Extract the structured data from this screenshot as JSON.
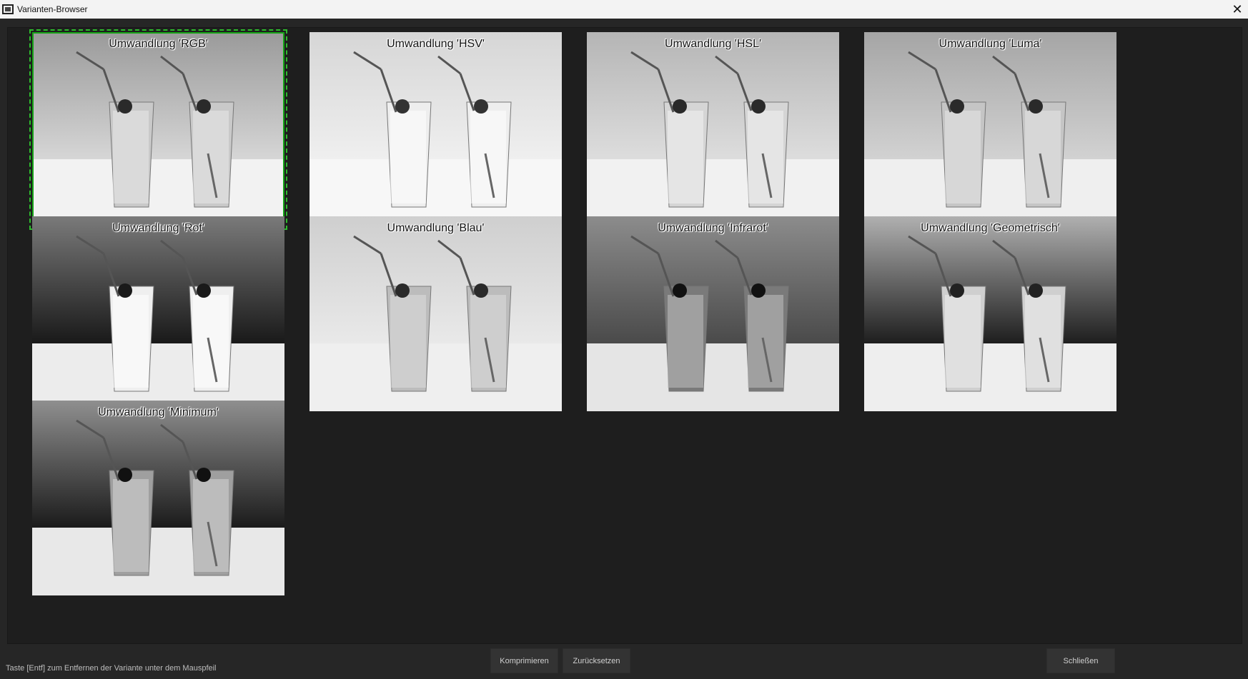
{
  "window": {
    "title": "Varianten-Browser",
    "close_icon": "close-icon",
    "app_icon": "film-icon"
  },
  "variants": [
    {
      "label": "Umwandlung 'RGB'",
      "selected": true,
      "tone": "rgb"
    },
    {
      "label": "Umwandlung 'HSV'",
      "selected": false,
      "tone": "hsv"
    },
    {
      "label": "Umwandlung 'HSL'",
      "selected": false,
      "tone": "hsl"
    },
    {
      "label": "Umwandlung 'Luma'",
      "selected": false,
      "tone": "luma"
    },
    {
      "label": "Umwandlung 'Rot'",
      "selected": false,
      "tone": "rot"
    },
    {
      "label": "Umwandlung 'Blau'",
      "selected": false,
      "tone": "blau"
    },
    {
      "label": "Umwandlung 'Infrarot'",
      "selected": false,
      "tone": "infrarot"
    },
    {
      "label": "Umwandlung 'Geometrisch'",
      "selected": false,
      "tone": "geo"
    },
    {
      "label": "Umwandlung 'Minimum'",
      "selected": false,
      "tone": "minimum"
    }
  ],
  "footer": {
    "hint": "Taste [Entf] zum Entfernen der Variante unter dem Mauspfeil",
    "compress_label": "Komprimieren",
    "reset_label": "Zurücksetzen",
    "close_label": "Schließen"
  },
  "colors": {
    "background": "#262626",
    "selection": "#16a316",
    "button": "#333333"
  }
}
